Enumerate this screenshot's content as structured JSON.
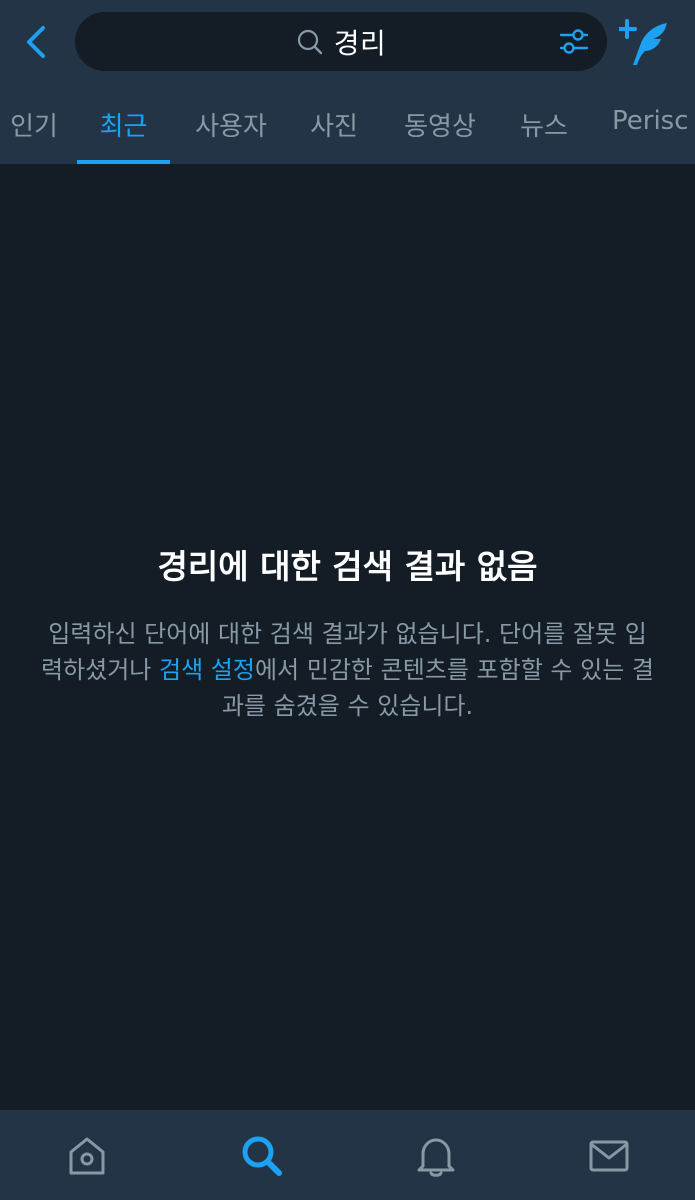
{
  "header": {
    "search_query": "경리",
    "accent_color": "#1da1f2",
    "back_icon": "back-arrow-icon",
    "filter_icon": "filter-sliders-icon",
    "compose_icon": "compose-tweet-icon"
  },
  "tabs": [
    {
      "label": "인기",
      "active": false
    },
    {
      "label": "최근",
      "active": true
    },
    {
      "label": "사용자",
      "active": false
    },
    {
      "label": "사진",
      "active": false
    },
    {
      "label": "동영상",
      "active": false
    },
    {
      "label": "뉴스",
      "active": false
    },
    {
      "label": "Perisc",
      "active": false
    }
  ],
  "empty_state": {
    "title": "경리에 대한 검색 결과 없음",
    "desc_part1": "입력하신 단어에 대한 검색 결과가 없습니다. 단어를 잘못 입력하셨거나 ",
    "desc_link": "검색 설정",
    "desc_part2": "에서 민감한 콘텐츠를 포함할 수 있는 결과를 숨겼을 수 있습니다."
  },
  "bottom_nav": {
    "items": [
      {
        "icon": "home-icon",
        "active": false
      },
      {
        "icon": "search-icon",
        "active": true
      },
      {
        "icon": "notifications-bell-icon",
        "active": false
      },
      {
        "icon": "messages-envelope-icon",
        "active": false
      }
    ]
  },
  "colors": {
    "background": "#141d26",
    "header_bg": "#243447",
    "inactive_text": "#8899a6"
  }
}
